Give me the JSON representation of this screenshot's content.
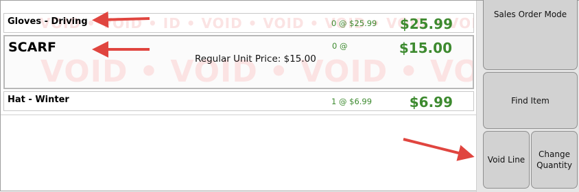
{
  "watermark": {
    "text": "VOID • VOID • VOID • VOID • VOID • VOID • V",
    "small_text": "VOID • VOID • ID • VOID • VOID • VOID • VOID • VOID • VOID • VO"
  },
  "lines": [
    {
      "name": "Gloves - Driving",
      "qty": "0 @ $25.99",
      "price": "$25.99"
    },
    {
      "name": "SCARF",
      "qty": "0 @",
      "price": "$15.00",
      "reg_price": "Regular Unit Price: $15.00"
    },
    {
      "name": "Hat - Winter",
      "qty": "1 @ $6.99",
      "price": "$6.99"
    }
  ],
  "buttons": {
    "sales_order_mode": "Sales Order Mode",
    "find_item": "Find Item",
    "void_line": "Void Line",
    "change_quantity": "Change Quantity"
  },
  "colors": {
    "price_green": "#3d8a2f",
    "arrow_red": "#e0453f",
    "watermark_pink": "#fbe3e3"
  }
}
